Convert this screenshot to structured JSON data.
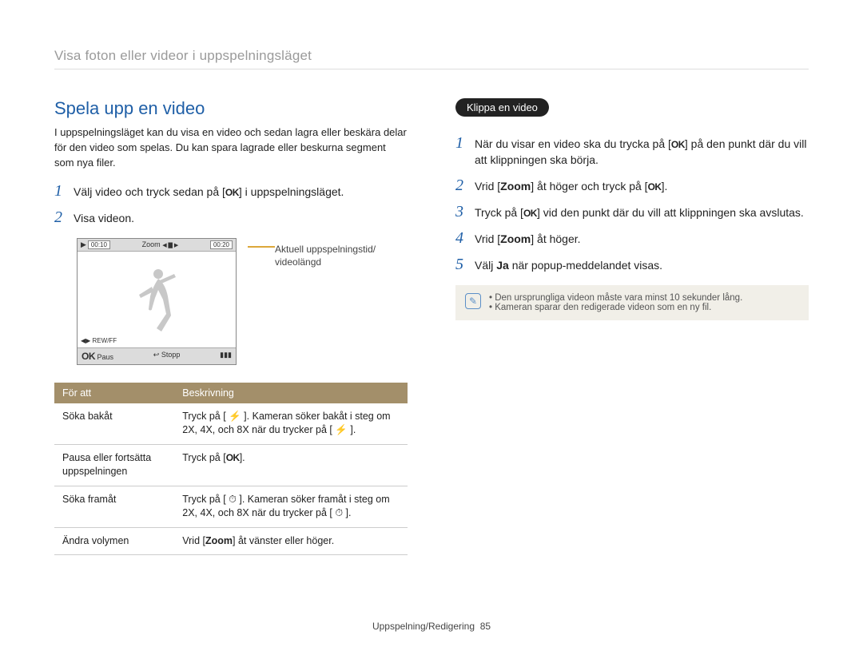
{
  "breadcrumb": "Visa foton eller videor i uppspelningsläget",
  "left": {
    "heading": "Spela upp en video",
    "intro": "I uppspelningsläget kan du visa en video och sedan lagra eller beskära delar för den video som spelas. Du kan spara lagrade eller beskurna segment som nya filer.",
    "step1_a": "Välj video och tryck sedan på [",
    "step1_b": "] i uppspelningsläget.",
    "step2": "Visa videon.",
    "screen": {
      "zoom_label": "Zoom",
      "time_cur": "00:10",
      "time_tot": "00:20",
      "rewff": "REW/FF",
      "paus_label": "Paus",
      "stopp_label": "Stopp"
    },
    "caption": "Aktuell uppspelningstid/\nvideolängd",
    "table": {
      "h1": "För att",
      "h2": "Beskrivning",
      "r1c1": "Söka bakåt",
      "r1c2": "Tryck på [ ⚡ ]. Kameran söker bakåt i steg om 2X, 4X, och 8X när du trycker på [ ⚡ ].",
      "r2c1": "Pausa eller fortsätta uppspelningen",
      "r2c2_a": "Tryck på [",
      "r2c2_b": "].",
      "r3c1": "Söka framåt",
      "r3c2": "Tryck på [ ⏱ ]. Kameran söker framåt i steg om 2X, 4X, och 8X när du trycker på [ ⏱ ].",
      "r4c1": "Ändra volymen",
      "r4c2_a": "Vrid [",
      "r4c2_b": "Zoom",
      "r4c2_c": "] åt vänster eller höger."
    }
  },
  "right": {
    "badge": "Klippa en video",
    "step1_a": "När du visar en video ska du trycka på [",
    "step1_b": "] på den punkt där du vill att klippningen ska börja.",
    "step2_a": "Vrid [",
    "step2_b": "Zoom",
    "step2_c": "] åt höger och tryck på [",
    "step2_d": "].",
    "step3_a": "Tryck på [",
    "step3_b": "] vid den punkt där du vill att klippningen ska avslutas.",
    "step4_a": "Vrid [",
    "step4_b": "Zoom",
    "step4_c": "] åt höger.",
    "step5_a": "Välj ",
    "step5_b": "Ja",
    "step5_c": " när popup-meddelandet visas.",
    "note1": "Den ursprungliga videon måste vara minst 10 sekunder lång.",
    "note2": "Kameran sparar den redigerade videon som en ny fil."
  },
  "ok_label": "OK",
  "footer": {
    "section": "Uppspelning/Redigering",
    "page": "85"
  }
}
